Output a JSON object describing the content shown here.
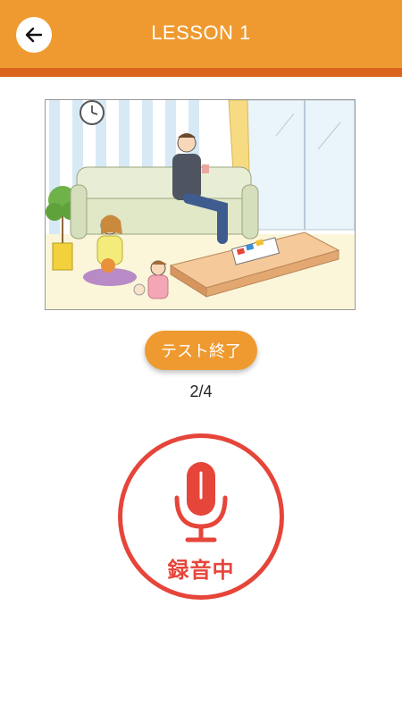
{
  "header": {
    "title": "LESSON 1",
    "back_icon": "arrow-left-icon"
  },
  "scene": {
    "description_icon": "living-room-illustration"
  },
  "actions": {
    "end_test_label": "テスト終了"
  },
  "progress": {
    "text": "2/4",
    "current": 2,
    "total": 4
  },
  "recorder": {
    "status_label": "録音中",
    "icon": "microphone-icon"
  },
  "colors": {
    "accent": "#EF9A30",
    "accent_dark": "#D9641E",
    "record": "#E6453A"
  }
}
